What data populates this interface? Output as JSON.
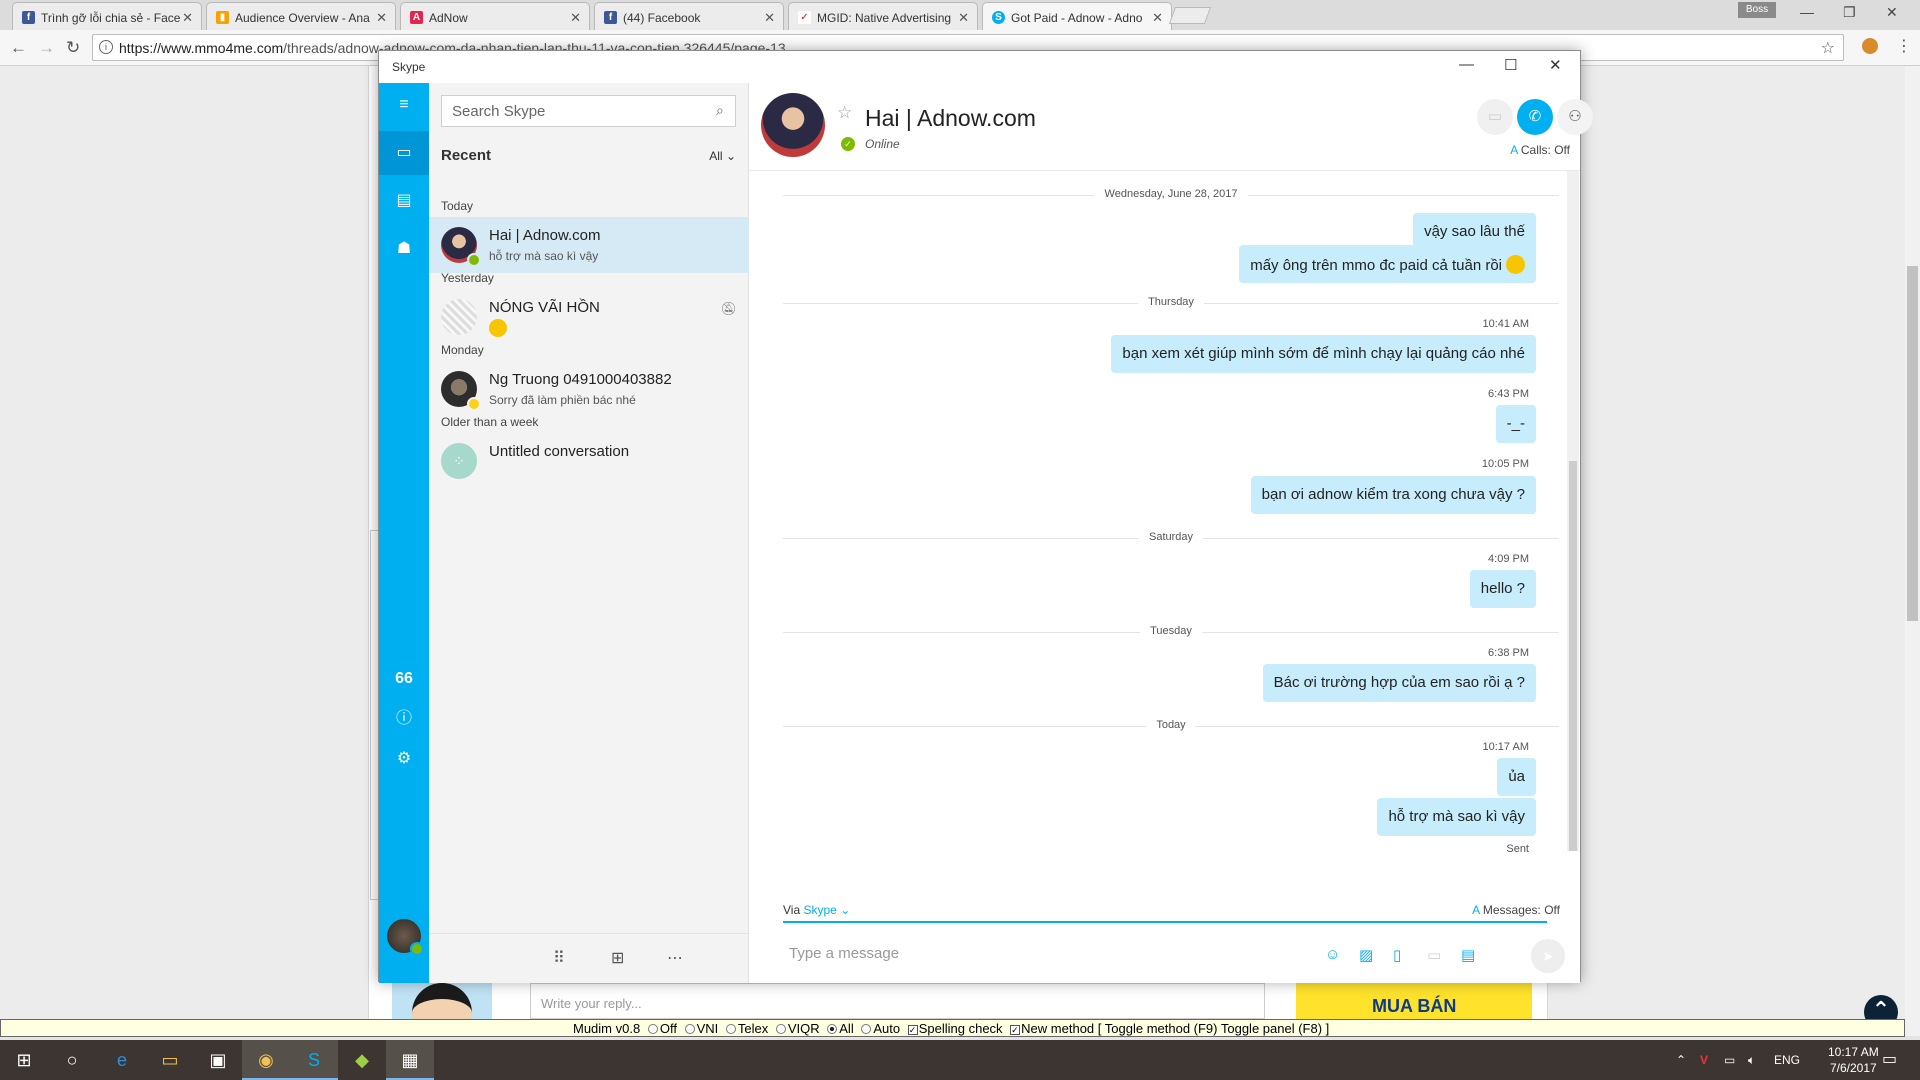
{
  "browser": {
    "tabs": [
      {
        "label": "Trình gỡ lỗi chia sẻ - Face",
        "icon": "facebook-icon"
      },
      {
        "label": "Audience Overview - Ana",
        "icon": "analytics-icon"
      },
      {
        "label": "AdNow",
        "icon": "adnow-icon"
      },
      {
        "label": "(44) Facebook",
        "icon": "facebook-icon"
      },
      {
        "label": "MGID: Native Advertising",
        "icon": "mgid-icon"
      },
      {
        "label": "Got Paid - Adnow - Adno",
        "icon": "skype-icon"
      }
    ],
    "profile": "Boss",
    "url": "https://www.mmo4me.com/threads/adnow-adnow-com-da-nhan-tien-lan-thu-11-va-con-tien.326445/page-13",
    "url_host": "https://www.mmo4me.com",
    "url_path": "/threads/adnow-adnow-com-da-nhan-tien-lan-thu-11-va-con-tien.326445/page-13"
  },
  "page": {
    "reply_placeholder": "Write your reply...",
    "ad_text": "MUA BÁN"
  },
  "mudim": {
    "version": "Mudim v0.8",
    "opt_off": "Off",
    "opt_vni": "VNI",
    "opt_telex": "Telex",
    "opt_viqr": "VIQR",
    "opt_all": "All",
    "opt_auto": "Auto",
    "spelling": "Spelling check",
    "new_method": "New method",
    "toggle_text": "[ Toggle method (F9) Toggle panel (F8) ]"
  },
  "taskbar": {
    "lang": "ENG",
    "time": "10:17 AM",
    "date": "7/6/2017"
  },
  "skype": {
    "title": "Skype",
    "search_placeholder": "Search Skype",
    "recent_label": "Recent",
    "filter_label": "All",
    "sections": {
      "today": "Today",
      "yesterday": "Yesterday",
      "monday": "Monday",
      "older": "Older than a week"
    },
    "conversations": [
      {
        "name": "Hai | Adnow.com",
        "preview": "hỗ trợ mà sao kì vậy",
        "status": "online"
      },
      {
        "name": "NÓNG VÃI HỒN",
        "preview": "",
        "status": "none"
      },
      {
        "name": "Ng Truong 0491000403882",
        "preview": "Sorry đã làm phiền bác nhé",
        "status": "away"
      },
      {
        "name": "Untitled conversation",
        "preview": "",
        "status": "group"
      }
    ],
    "rail_quote": "66",
    "chat": {
      "name": "Hai | Adnow.com",
      "status": "Online",
      "calls": "Calls: Off",
      "date_sep_1": "Wednesday, June 28, 2017",
      "date_sep_2": "Thursday",
      "date_sep_3": "Saturday",
      "date_sep_4": "Tuesday",
      "date_sep_5": "Today",
      "messages": [
        {
          "text": "vậy sao lâu thế",
          "time": ""
        },
        {
          "text": "mấy ông trên mmo đc paid cả tuần rồi",
          "time": ""
        },
        {
          "text": "bạn xem xét giúp mình sớm để mình chạy lại quảng cáo nhé",
          "time": "10:41 AM"
        },
        {
          "text": "-_-",
          "time": "6:43 PM"
        },
        {
          "text": "bạn ơi adnow kiểm tra xong chưa vậy ?",
          "time": "10:05 PM"
        },
        {
          "text": "hello ?",
          "time": "4:09 PM"
        },
        {
          "text": "Bác ơi trường hợp của em sao rồi ạ ?",
          "time": "6:38 PM"
        },
        {
          "text": "ủa",
          "time": "10:17 AM"
        },
        {
          "text": "hỗ trợ mà sao kì vậy",
          "time": ""
        }
      ],
      "sent_label": "Sent",
      "via_label": "Via",
      "via_service": "Skype",
      "messages_off": "Messages: Off",
      "compose_placeholder": "Type a message"
    }
  },
  "colors": {
    "skype_blue": "#00aff0",
    "bubble": "#c7edfc",
    "online": "#7fba00",
    "away": "#fcd116"
  }
}
